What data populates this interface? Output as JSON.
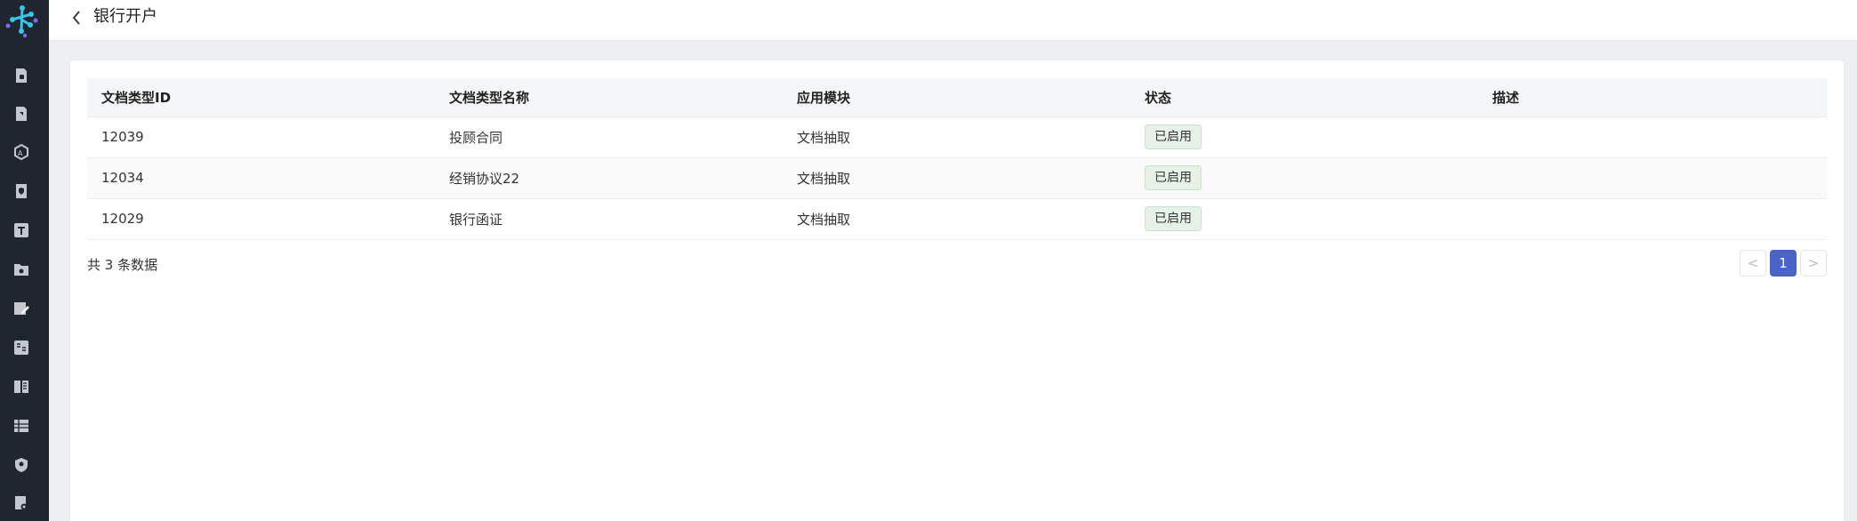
{
  "header": {
    "title": "银行开户"
  },
  "table": {
    "columns": [
      "文档类型ID",
      "文档类型名称",
      "应用模块",
      "状态",
      "描述"
    ],
    "rows": [
      {
        "id": "12039",
        "name": "投顾合同",
        "module": "文档抽取",
        "status": "已启用",
        "desc": ""
      },
      {
        "id": "12034",
        "name": "经销协议22",
        "module": "文档抽取",
        "status": "已启用",
        "desc": ""
      },
      {
        "id": "12029",
        "name": "银行函证",
        "module": "文档抽取",
        "status": "已启用",
        "desc": ""
      }
    ]
  },
  "footer": {
    "total": "共 3 条数据",
    "current_page": "1",
    "prev_symbol": "<",
    "next_symbol": ">"
  },
  "colors": {
    "sidebar_bg": "#20262f",
    "accent": "#4a63c6",
    "badge_bg": "#e6f2e8"
  },
  "icons": {
    "sidebar": [
      "doc-lock-icon",
      "doc-tag-icon",
      "hexagon-text-icon",
      "doc-shield-icon",
      "text-t-icon",
      "folder-search-icon",
      "edit-form-icon",
      "compare-text-icon",
      "book-icon",
      "table-grid-icon",
      "shield-badge-icon",
      "doc-settings-icon"
    ]
  }
}
